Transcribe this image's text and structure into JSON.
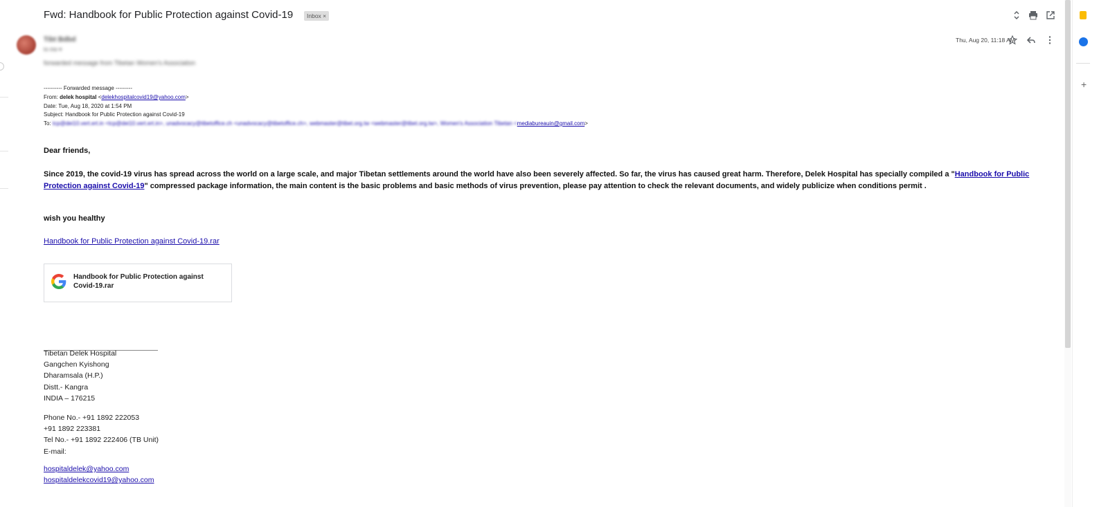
{
  "subject": "Fwd: Handbook for Public Protection against Covid-19",
  "inbox_chip": "Inbox ×",
  "sender": {
    "name": "Tibt Bdbd",
    "to_line": "to me ▾",
    "intro": "forwarded message from Tibetan Women's Association"
  },
  "date_time": "Thu, Aug 20, 11:18 AM",
  "forwarded": {
    "divider": "---------- Forwarded message ---------",
    "from_label": "From: ",
    "from_name": "delek hospital",
    "from_email_open": " <",
    "from_email": "delekhospitalcovid19@yahoo.com",
    "from_email_close": ">",
    "date": "Date: Tue, Aug 18, 2020 at 1:54 PM",
    "subject": "Subject: Handbook for Public Protection against Covid-19",
    "to_label": "To: ",
    "to_blurred_1": "tcp@dei10.vert.ert.in <tcp@dei10.vert.ert.in>, unadvocacy@tibetoffice.ch <unadvocacy@tibetoffice.ch>, webmaster@tibet.org.tw <webmaster@tibet.org.tw>, Women's Association Tibetan <",
    "to_email": "mediabureauin@gmail.com",
    "to_close": ">"
  },
  "body": {
    "greeting": "Dear friends,",
    "para_start": "Since 2019, the covid-19 virus has spread across the world on a large scale, and major Tibetan settlements around the world have also been severely affected.  So far, the virus has caused great harm. Therefore, Delek Hospital has specially compiled a \"",
    "para_link": "Handbook for Public Protection against Covid-19",
    "para_end": "\" compressed package information, the main content is the basic problems and basic methods of virus prevention, please pay attention to check the relevant documents, and widely publicize when conditions permit .",
    "closing": "wish you healthy",
    "rar_link": "Handbook for Public Protection against Covid-19.rar"
  },
  "attachment": {
    "name": "Handbook for Public Protection against Covid-19.rar",
    "icon": "google-g-icon"
  },
  "signature": {
    "lines": [
      "Tibetan Delek Hospital",
      "Gangchen Kyishong",
      "Dharamsala (H.P.)",
      "Distt.- Kangra",
      "INDIA – 176215"
    ],
    "phone": [
      "Phone No.- +91 1892 222053",
      "+91 1892 223381",
      "Tel No.- +91 1892 222406 (TB Unit)",
      "E-mail:"
    ],
    "emails": [
      "hospitaldelek@yahoo.com",
      "hospitaldelekcovid19@yahoo.com"
    ]
  },
  "colors": {
    "link": "#1a0dab",
    "accent_blue": "#1a73e8",
    "accent_yellow": "#fbbc04"
  }
}
